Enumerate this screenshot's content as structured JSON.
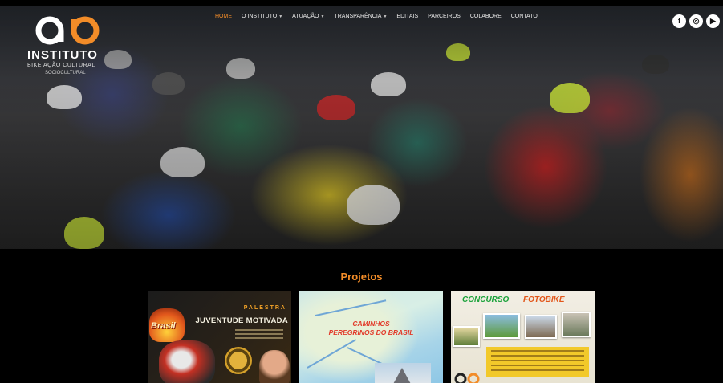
{
  "brand": {
    "name": "INSTITUTO",
    "subtitle": "BIKE AÇÃO CULTURAL",
    "subtitle2": "SOCIOCULTURAL",
    "accent_color": "#f28c28"
  },
  "nav": {
    "items": [
      {
        "label": "Home",
        "active": true,
        "has_dropdown": false
      },
      {
        "label": "O Instituto",
        "active": false,
        "has_dropdown": true
      },
      {
        "label": "Atuação",
        "active": false,
        "has_dropdown": true
      },
      {
        "label": "Transparência",
        "active": false,
        "has_dropdown": true
      },
      {
        "label": "Editais",
        "active": false,
        "has_dropdown": false
      },
      {
        "label": "Parceiros",
        "active": false,
        "has_dropdown": false
      },
      {
        "label": "Colabore",
        "active": false,
        "has_dropdown": false
      },
      {
        "label": "Contato",
        "active": false,
        "has_dropdown": false
      }
    ]
  },
  "socials": [
    {
      "name": "facebook-icon",
      "glyph": "f"
    },
    {
      "name": "instagram-icon",
      "glyph": "◎"
    },
    {
      "name": "youtube-icon",
      "glyph": "▶"
    }
  ],
  "projects": {
    "title": "Projetos",
    "cards": [
      {
        "palestra": "PALESTRA",
        "heading": "JUVENTUDE MOTIVADA",
        "logo_text": "Brasil"
      },
      {
        "heading_line1": "CAMINHOS",
        "heading_line2": "PEREGRINOS DO BRASIL"
      },
      {
        "heading_part1": "CONCURSO",
        "heading_part2": "FOTOBIKE"
      }
    ]
  }
}
